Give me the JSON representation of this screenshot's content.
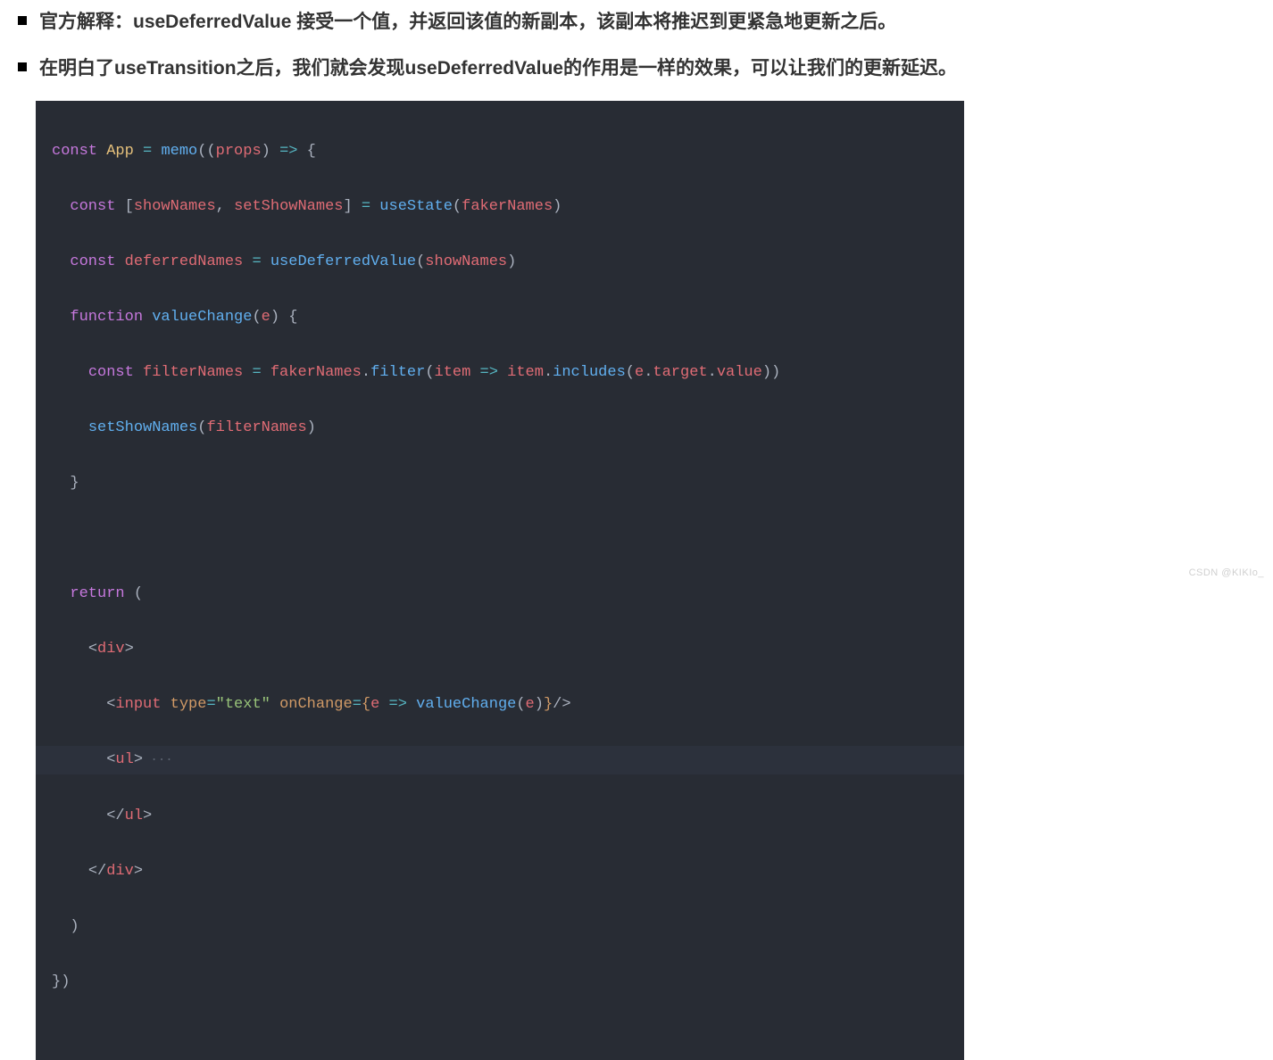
{
  "bullets": {
    "b1": "官方解释：useDeferredValue 接受一个值，并返回该值的新副本，该副本将推迟到更紧急地更新之后。",
    "b2": "在明白了useTransition之后，我们就会发现useDeferredValue的作用是一样的效果，可以让我们的更新延迟。"
  },
  "code": {
    "kw_const": "const",
    "kw_function": "function",
    "kw_return": "return",
    "app": "App",
    "memo": "memo",
    "props": "props",
    "showNames": "showNames",
    "setShowNames": "setShowNames",
    "useState": "useState",
    "fakerNames": "fakerNames",
    "deferredNames": "deferredNames",
    "useDeferredValue": "useDeferredValue",
    "valueChange": "valueChange",
    "e": "e",
    "filterNames": "filterNames",
    "filter": "filter",
    "item": "item",
    "includes": "includes",
    "target": "target",
    "value": "value",
    "div": "div",
    "input": "input",
    "type": "type",
    "text_str": "\"text\"",
    "onChange": "onChange",
    "ul": "ul",
    "arrow": "=>",
    "eq": "="
  },
  "watermark": "CSDN @KIKIo_"
}
